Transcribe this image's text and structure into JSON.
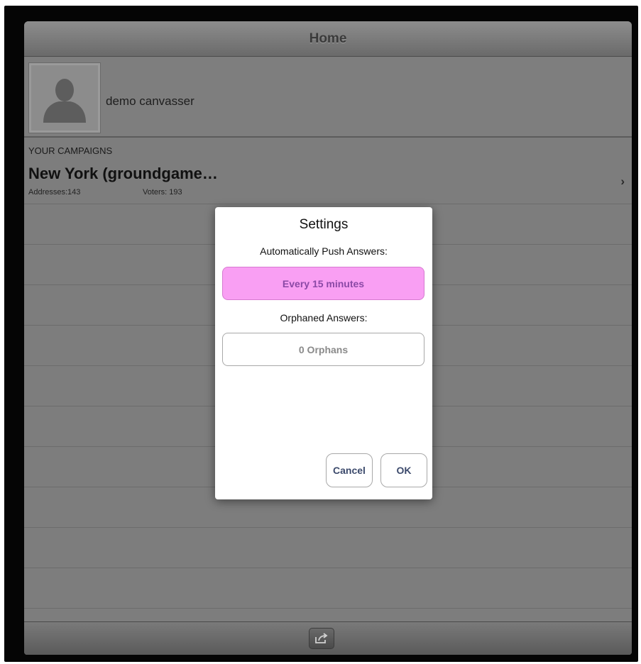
{
  "navbar": {
    "title": "Home"
  },
  "profile": {
    "name": "demo canvasser"
  },
  "campaigns": {
    "section_header": "YOUR CAMPAIGNS",
    "items": [
      {
        "title": "New York (groundgame…",
        "addresses": "Addresses:143",
        "voters": "Voters: 193"
      }
    ]
  },
  "dialog": {
    "title": "Settings",
    "push_label": "Automatically Push Answers:",
    "push_value": "Every 15 minutes",
    "orphan_label": "Orphaned Answers:",
    "orphan_value": "0 Orphans",
    "cancel_label": "Cancel",
    "ok_label": "OK"
  },
  "toolbar": {
    "action_icon": "share-icon"
  },
  "colors": {
    "push_button_bg": "#f99ff3",
    "push_button_text": "#8b49a6",
    "button_text": "#3c4a6c"
  }
}
